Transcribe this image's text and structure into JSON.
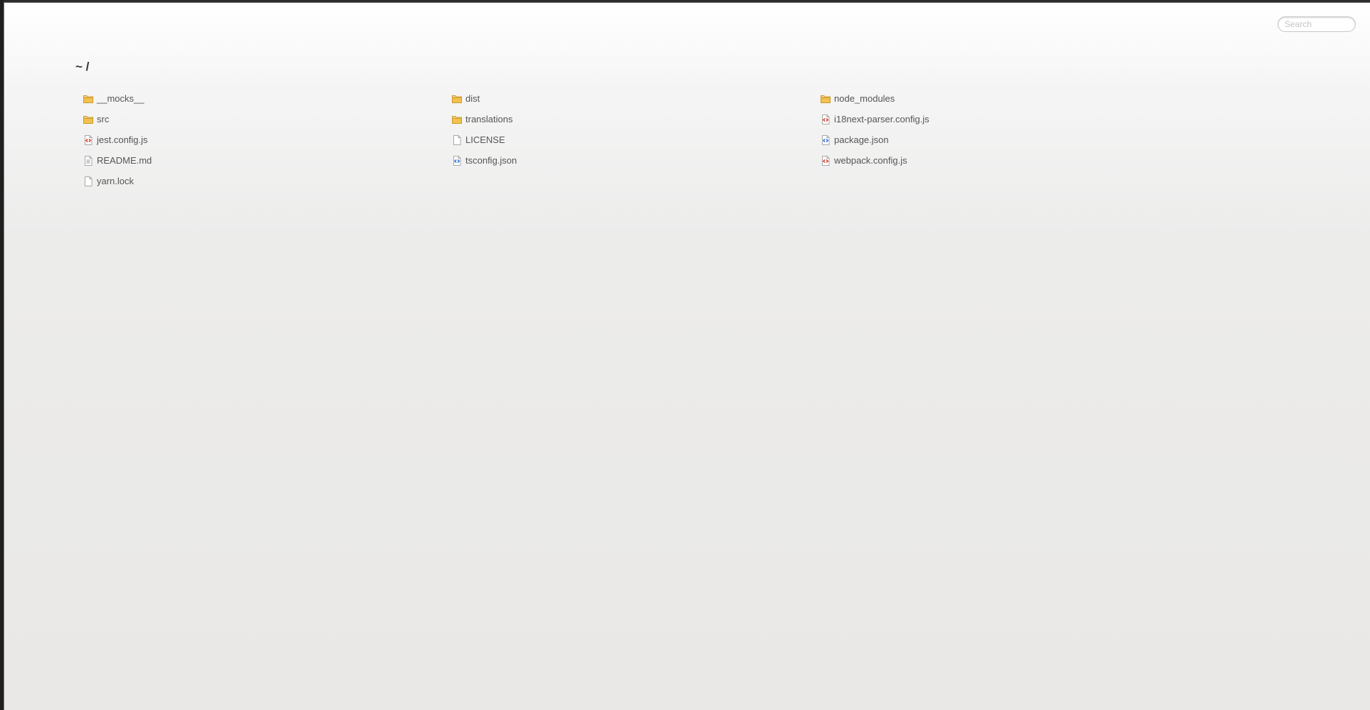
{
  "search": {
    "placeholder": "Search"
  },
  "path": {
    "title": "~ /"
  },
  "colors": {
    "folder": "#f2c14e",
    "code_js": "#d9463c",
    "code_json": "#3a7bd5",
    "doc": "#9a9a9a"
  },
  "files": [
    {
      "name": "__mocks__",
      "type": "folder",
      "icon": "folder-icon"
    },
    {
      "name": "dist",
      "type": "folder",
      "icon": "folder-icon"
    },
    {
      "name": "node_modules",
      "type": "folder",
      "icon": "folder-icon"
    },
    {
      "name": "src",
      "type": "folder",
      "icon": "folder-icon"
    },
    {
      "name": "translations",
      "type": "folder",
      "icon": "folder-icon"
    },
    {
      "name": "i18next-parser.config.js",
      "type": "js",
      "icon": "js-file-icon"
    },
    {
      "name": "jest.config.js",
      "type": "js",
      "icon": "js-file-icon"
    },
    {
      "name": "LICENSE",
      "type": "plain",
      "icon": "blank-file-icon"
    },
    {
      "name": "package.json",
      "type": "json",
      "icon": "json-file-icon"
    },
    {
      "name": "README.md",
      "type": "text",
      "icon": "text-file-icon"
    },
    {
      "name": "tsconfig.json",
      "type": "json",
      "icon": "json-file-icon"
    },
    {
      "name": "webpack.config.js",
      "type": "js",
      "icon": "js-file-icon"
    },
    {
      "name": "yarn.lock",
      "type": "plain",
      "icon": "blank-file-icon"
    }
  ]
}
